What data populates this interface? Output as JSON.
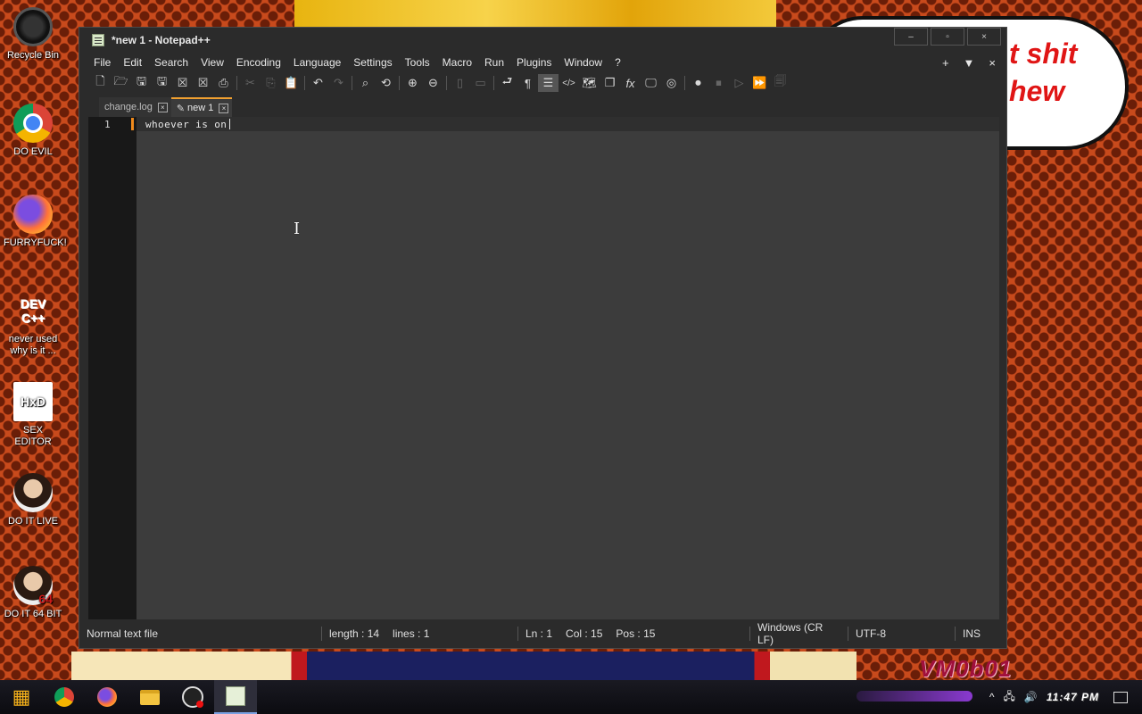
{
  "desktop": {
    "speech_lines": [
      "t shit",
      "hew"
    ],
    "watermark": "VM0b01",
    "icons": [
      {
        "label": "Recycle Bin",
        "icon": "recycle-bin-icon"
      },
      {
        "label": "DO EVIL",
        "icon": "chrome-icon"
      },
      {
        "label": "FURRYFUCK!",
        "icon": "firefox-icon"
      },
      {
        "label": "never used why is it ...",
        "icon": "dev-cpp-icon",
        "glyph": "DEV C++"
      },
      {
        "label": "SEX EDITOR",
        "icon": "hxd-icon",
        "glyph": "HxD"
      },
      {
        "label": "DO IT LIVE",
        "icon": "portrait-icon"
      },
      {
        "label": "DO IT 64 BIT",
        "icon": "portrait-64-icon",
        "glyph": "64"
      }
    ]
  },
  "window": {
    "title": "*new 1 - Notepad++",
    "controls": {
      "minimize": "–",
      "maximize": "▫",
      "close": "×"
    },
    "menu": [
      "File",
      "Edit",
      "Search",
      "View",
      "Encoding",
      "Language",
      "Settings",
      "Tools",
      "Macro",
      "Run",
      "Plugins",
      "Window",
      "?"
    ],
    "menu_right": {
      "add": "+",
      "dropdown": "▼",
      "close": "×"
    },
    "tabs": [
      {
        "label": "change.log",
        "close": "×"
      },
      {
        "label": "new 1",
        "close": "×",
        "modified_glyph": "✎"
      }
    ],
    "editor": {
      "line_number": "1",
      "text": "whoever is on"
    },
    "status": {
      "file_type": "Normal text file",
      "length": "length : 14",
      "lines": "lines : 1",
      "ln": "Ln : 1",
      "col": "Col : 15",
      "pos": "Pos : 15",
      "eol": "Windows (CR LF)",
      "encoding": "UTF-8",
      "mode": "INS"
    }
  },
  "taskbar": {
    "clock": "11:47 PM",
    "tray_volume": "🔊",
    "tray_network": "🖧",
    "tray_chevron": "^"
  },
  "toolbar_glyphs": {
    "new": "🗋",
    "open": "🗁",
    "save": "🖫",
    "save_all": "🖫",
    "close": "☒",
    "close_all": "☒",
    "print": "⎙",
    "cut": "✂",
    "copy": "⎘",
    "paste": "📋",
    "undo": "↶",
    "redo": "↷",
    "find": "⌕",
    "replace": "⟲",
    "zoom_in": "⊕",
    "zoom_out": "⊖",
    "sync_v": "▯",
    "sync_h": "▭",
    "wrap": "⮐",
    "all_chars": "¶",
    "indent_guide": "☰",
    "udl": "</>",
    "doc_map": "🗺",
    "doc_list": "❐",
    "func_list": "fx",
    "monitor": "🖵",
    "screenshot": "◎",
    "record": "⏺",
    "stop": "⏹",
    "play": "▷",
    "run_multi": "⏩",
    "save_macro": "🗐"
  },
  "colors": {
    "accent": "#f0a030",
    "editor_bg": "#3c3c3c",
    "window_bg": "#2b2b2b"
  }
}
